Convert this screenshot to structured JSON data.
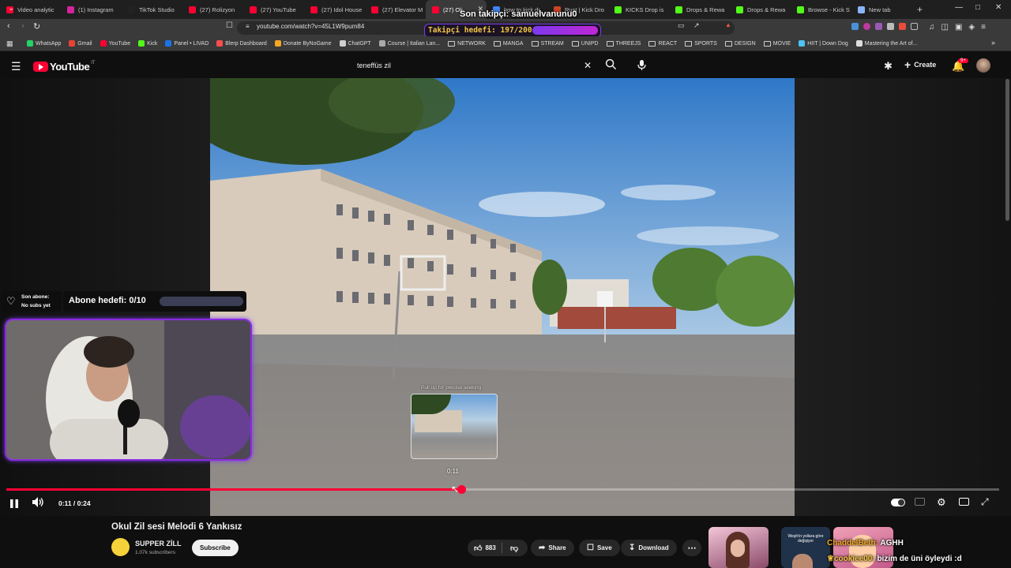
{
  "browser": {
    "tabs": [
      {
        "label": "Video analytic",
        "color": "#ff0033"
      },
      {
        "label": "(1) Instagram",
        "color": "#d6249f"
      },
      {
        "label": "TikTok Studio",
        "color": "#222222"
      },
      {
        "label": "(27) Rolizyon",
        "color": "#ff0033"
      },
      {
        "label": "(27) YouTube",
        "color": "#ff0033"
      },
      {
        "label": "(27) Idol House",
        "color": "#ff0033"
      },
      {
        "label": "(27) Elevator M",
        "color": "#ff0033"
      },
      {
        "label": "(27) Ok",
        "color": "#ff0033"
      },
      {
        "label": "how to kick dr",
        "color": "#4285f4"
      },
      {
        "label": "Rust | Kick Dro",
        "color": "#cd4422"
      },
      {
        "label": "KICKS Drop is",
        "color": "#53fc18"
      },
      {
        "label": "Drops & Rewa",
        "color": "#53fc18"
      },
      {
        "label": "Drops & Rewa",
        "color": "#53fc18"
      },
      {
        "label": "Browse - Kick S",
        "color": "#53fc18"
      },
      {
        "label": "New tab",
        "color": "#8ab4f8"
      }
    ],
    "new_tab_symbol": "+",
    "url": "youtube.com/watch?v=45L1W9pum84",
    "bookmarks": [
      {
        "label": "WhatsApp",
        "type": "site",
        "color": "#25d366"
      },
      {
        "label": "Gmail",
        "type": "site",
        "color": "#ea4335"
      },
      {
        "label": "YouTube",
        "type": "site",
        "color": "#ff0033"
      },
      {
        "label": "Kick",
        "type": "site",
        "color": "#53fc18"
      },
      {
        "label": "Panel • LIVAD",
        "type": "site",
        "color": "#1a73e8"
      },
      {
        "label": "Blerp Dashboard",
        "type": "site",
        "color": "#ff4d4d"
      },
      {
        "label": "Donate ByNoGame",
        "type": "site",
        "color": "#f5a623"
      },
      {
        "label": "ChatGPT",
        "type": "site",
        "color": "#d0d0d0"
      },
      {
        "label": "Course | Italian Lan...",
        "type": "site",
        "color": "#aaaaaa"
      },
      {
        "label": "NETWORK",
        "type": "folder"
      },
      {
        "label": "MANGA",
        "type": "folder"
      },
      {
        "label": "STREAM",
        "type": "folder"
      },
      {
        "label": "UNIPD",
        "type": "folder"
      },
      {
        "label": "THREEJS",
        "type": "folder"
      },
      {
        "label": "REACT",
        "type": "folder"
      },
      {
        "label": "SPORTS",
        "type": "folder"
      },
      {
        "label": "DESIGN",
        "type": "folder"
      },
      {
        "label": "MOVIE",
        "type": "folder"
      },
      {
        "label": "HIIT | Down Dog",
        "type": "site",
        "color": "#4fc3f7"
      },
      {
        "label": "Mastering the Art of...",
        "type": "site",
        "color": "#dddddd"
      }
    ]
  },
  "stream_overlay": {
    "last_follower": "Son takipçi: samuelvanunu0",
    "follower_goal": "Takipçi hedefi: 197/200",
    "follower_goal_fraction": 0.985,
    "last_sub_title": "Son abone:",
    "last_sub_value": "No subs yet",
    "sub_goal": "Abone hedefi: 0/10",
    "sub_goal_fraction": 0.0,
    "chat": [
      {
        "user": "ChaddelBeth:",
        "message": "AGHH",
        "user_color": "#f5a623"
      },
      {
        "user": "cookiee00:",
        "message": "bizim de üni öyleydi :d",
        "user_color": "#f5c543"
      }
    ]
  },
  "youtube": {
    "logo_text": "YouTube",
    "region": "IT",
    "search_query": "teneffüs zil",
    "create_label": "Create",
    "notifications_badge": "9+",
    "player": {
      "seek_hint": "Pull up for precise seeking",
      "hover_time": "0:11",
      "time_display": "0:11 / 0:24",
      "progress_fraction": 0.4583
    },
    "video_title": "Okul Zil sesi Melodi 6 Yankısız",
    "channel_name": "SUPPER ZİLL",
    "subscribers": "1.07k subscribers",
    "subscribe_label": "Subscribe",
    "like_count": "883",
    "share_label": "Share",
    "save_label": "Save",
    "download_label": "Download",
    "thumb_caption": "Weşh'in yollara göre değişiyor"
  }
}
